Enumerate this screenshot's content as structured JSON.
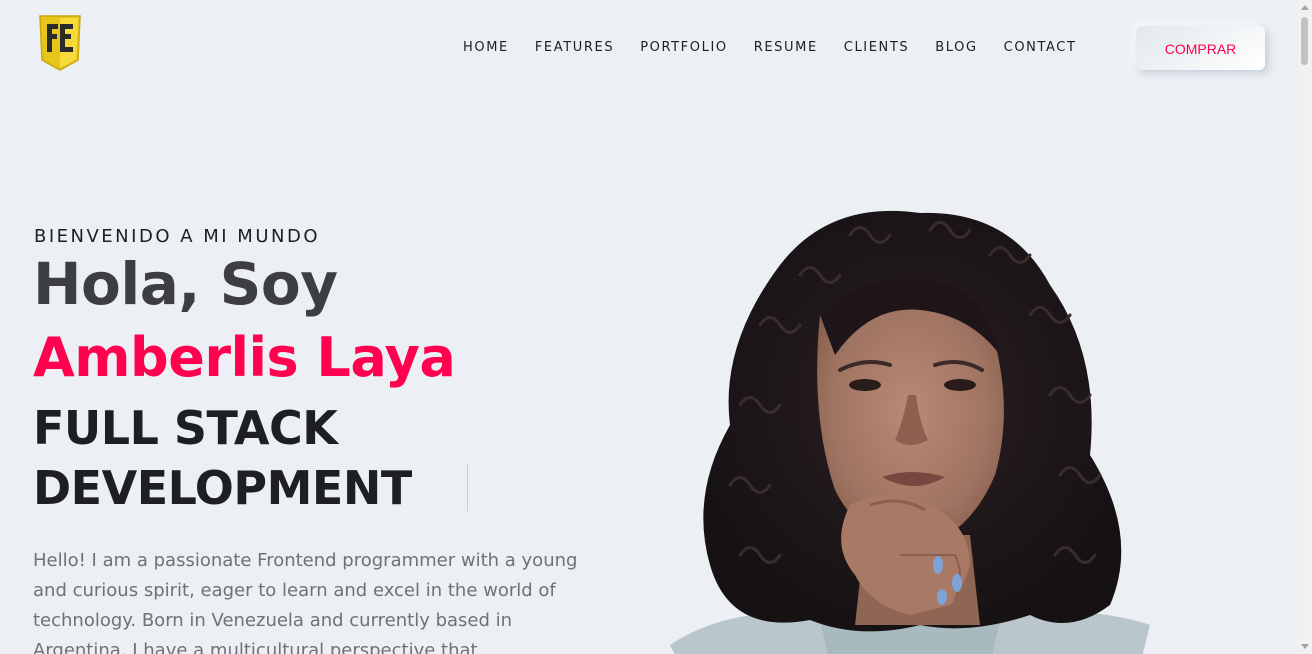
{
  "header": {
    "logo_icon": "fe-shield-logo-icon",
    "nav": [
      {
        "label": "HOME"
      },
      {
        "label": "FEATURES"
      },
      {
        "label": "PORTFOLIO"
      },
      {
        "label": "RESUME"
      },
      {
        "label": "CLIENTS"
      },
      {
        "label": "BLOG"
      },
      {
        "label": "CONTACT"
      }
    ],
    "buy_label": "COMPRAR"
  },
  "hero": {
    "welcome": "BIENVENIDO A MI MUNDO",
    "greeting": "Hola, Soy",
    "name": "Amberlis Laya",
    "role": "FULL STACK DEVELOPMENT",
    "bio": "Hello! I am a passionate Frontend programmer with a young and curious spirit, eager to learn and excel in the world of technology. Born in Venezuela and currently based in Argentina, I have a multicultural perspective that"
  },
  "colors": {
    "background": "#eceff3",
    "accent": "#ff014f",
    "heading": "#3c3e41",
    "text": "#1d1f22",
    "body_text": "#6e7177",
    "logo_yellow": "#f2d022"
  }
}
